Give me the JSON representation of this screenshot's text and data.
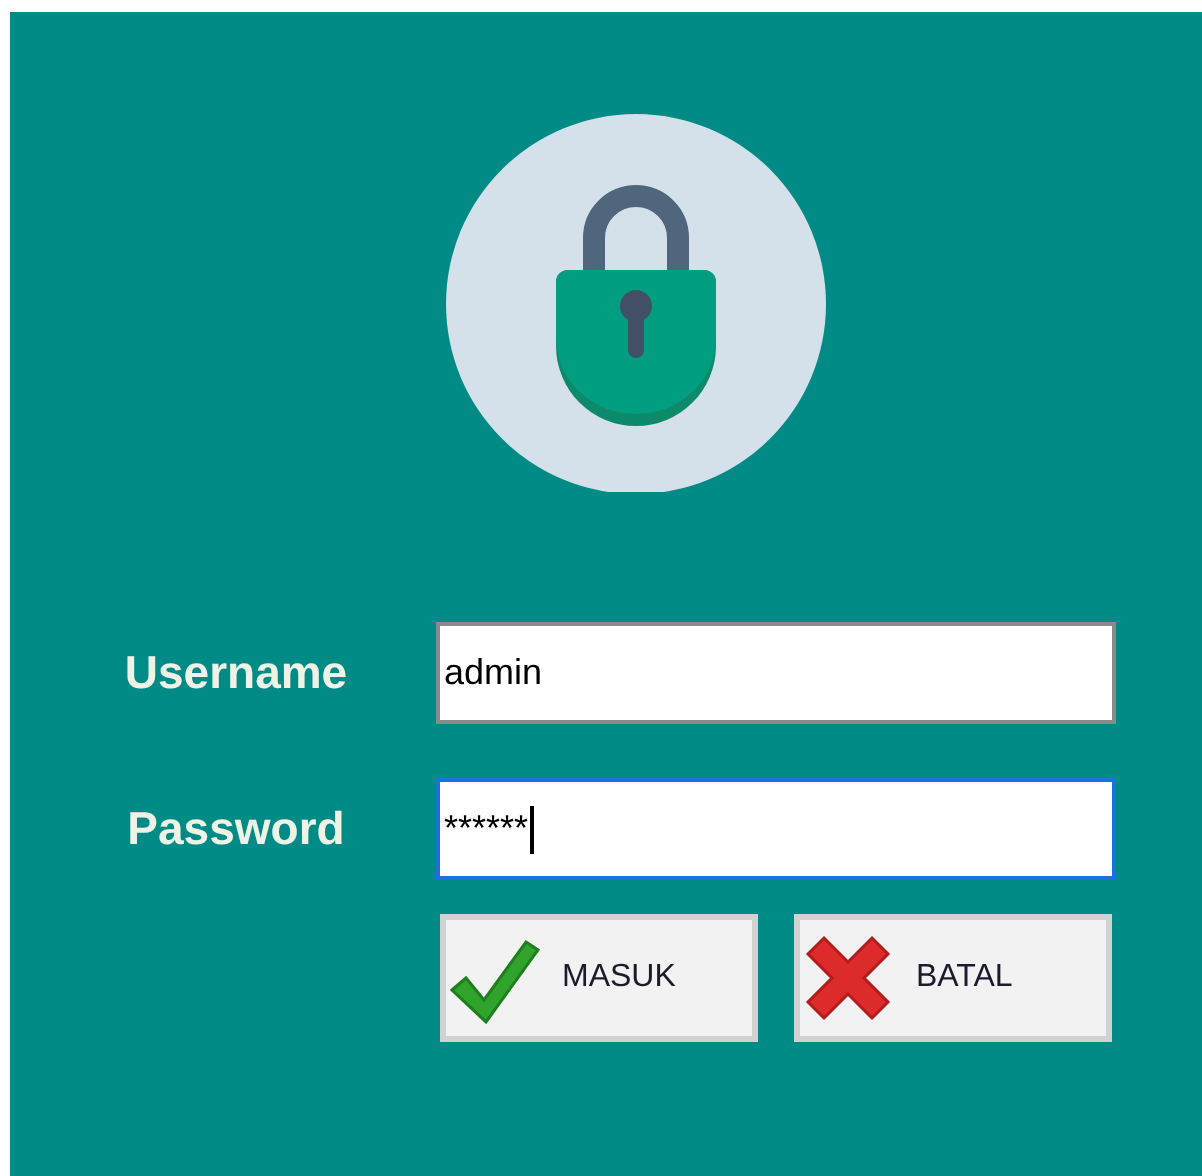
{
  "fields": [
    {
      "label": "Username",
      "value": "admin",
      "focused": false
    },
    {
      "label": "Password",
      "value": "******",
      "focused": true
    }
  ],
  "buttons": [
    {
      "kind": "ok",
      "label": "MASUK"
    },
    {
      "kind": "cancel",
      "label": "BATAL"
    }
  ]
}
